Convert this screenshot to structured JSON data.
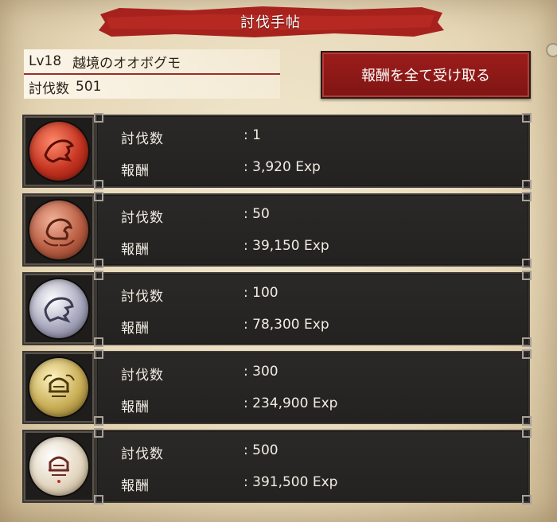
{
  "header": {
    "title": "討伐手帖"
  },
  "monster": {
    "level": "Lv18",
    "name": "越境のオオボグモ",
    "kills_label": "討伐数",
    "kills_value": "501"
  },
  "claim_button": {
    "label": "報酬を全て受け取る"
  },
  "rewards": [
    {
      "medal": "red-beast-medal-icon",
      "kills_label": "討伐数",
      "kills": ": 1",
      "reward_label": "報酬",
      "reward": ": 3,920 Exp"
    },
    {
      "medal": "copper-beast-medal-icon",
      "kills_label": "討伐数",
      "kills": ": 50",
      "reward_label": "報酬",
      "reward": ": 39,150 Exp"
    },
    {
      "medal": "silver-beast-medal-icon",
      "kills_label": "討伐数",
      "kills": ": 100",
      "reward_label": "報酬",
      "reward": ": 78,300 Exp"
    },
    {
      "medal": "gold-helmet-medal-icon",
      "kills_label": "討伐数",
      "kills": ": 300",
      "reward_label": "報酬",
      "reward": ": 234,900 Exp"
    },
    {
      "medal": "platinum-helmet-medal-icon",
      "kills_label": "討伐数",
      "kills": ": 500",
      "reward_label": "報酬",
      "reward": ": 391,500 Exp"
    }
  ],
  "colors": {
    "banner": "#a7221d",
    "button": "#8c1a17",
    "panel": "#262523",
    "text_light": "#f1ece4"
  }
}
